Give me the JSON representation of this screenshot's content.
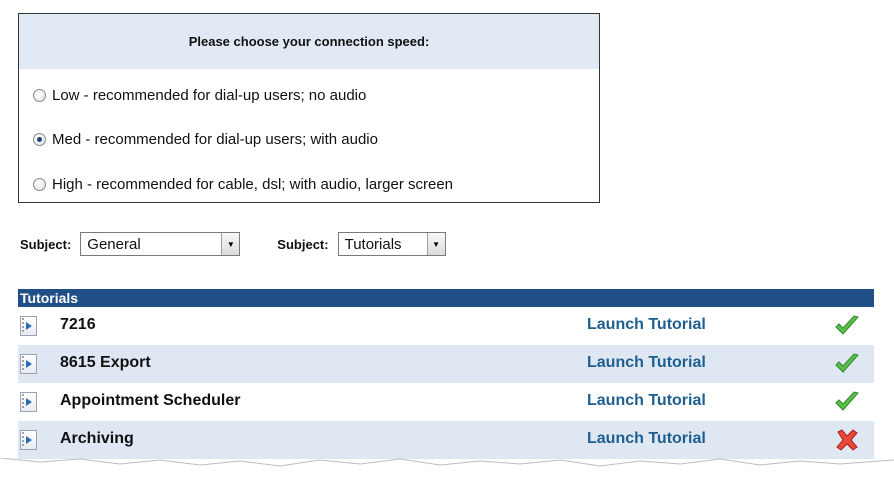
{
  "speed": {
    "heading": "Please choose your connection speed:",
    "options": [
      {
        "label": "Low - recommended for dial-up users; no audio",
        "selected": false
      },
      {
        "label": "Med - recommended for dial-up users; with audio",
        "selected": true
      },
      {
        "label": "High - recommended for cable, dsl; with audio, larger screen",
        "selected": false
      }
    ]
  },
  "filters": [
    {
      "label": "Subject:",
      "value": "General"
    },
    {
      "label": "Subject:",
      "value": "Tutorials"
    }
  ],
  "tutorials": {
    "header": "Tutorials",
    "rows": [
      {
        "name": "7216",
        "action": "Launch Tutorial",
        "status": "check-icon"
      },
      {
        "name": "8615 Export",
        "action": "Launch Tutorial",
        "status": "check-icon"
      },
      {
        "name": "Appointment Scheduler",
        "action": "Launch Tutorial",
        "status": "check-icon"
      },
      {
        "name": "Archiving",
        "action": "Launch Tutorial",
        "status": "cross-icon"
      }
    ]
  },
  "colors": {
    "header_bg": "#1f4f84",
    "row_alt": "#dfe7f2",
    "link": "#1f5f8f",
    "check": "#4caf50",
    "cross": "#e53935"
  }
}
